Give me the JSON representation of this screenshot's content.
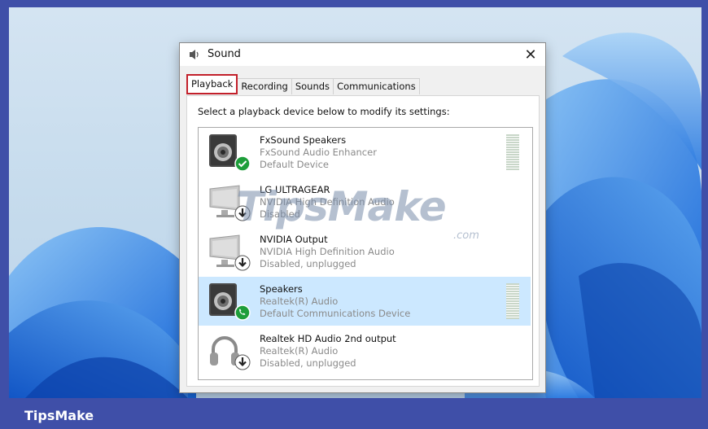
{
  "window": {
    "title": "Sound",
    "close_glyph": "✕",
    "icon": "speaker-icon"
  },
  "tabs": [
    {
      "label": "Playback",
      "active": true
    },
    {
      "label": "Recording",
      "active": false
    },
    {
      "label": "Sounds",
      "active": false
    },
    {
      "label": "Communications",
      "active": false
    }
  ],
  "instructions": "Select a playback device below to modify its settings:",
  "devices": [
    {
      "name": "FxSound Speakers",
      "line1": "FxSound Audio Enhancer",
      "line2": "Default Device",
      "icon": "speaker-icon",
      "badge": "check-badge-icon",
      "selected": false
    },
    {
      "name": "LG ULTRAGEAR",
      "line1": "NVIDIA High Definition Audio",
      "line2": "Disabled",
      "icon": "monitor-icon",
      "badge": "down-arrow-badge-icon",
      "selected": false
    },
    {
      "name": "NVIDIA Output",
      "line1": "NVIDIA High Definition Audio",
      "line2": "Disabled, unplugged",
      "icon": "monitor-icon",
      "badge": "down-arrow-badge-icon",
      "selected": false
    },
    {
      "name": "Speakers",
      "line1": "Realtek(R) Audio",
      "line2": "Default Communications Device",
      "icon": "speaker-icon",
      "badge": "phone-badge-icon",
      "selected": true
    },
    {
      "name": "Realtek HD Audio 2nd output",
      "line1": "Realtek(R) Audio",
      "line2": "Disabled, unplugged",
      "icon": "headphones-icon",
      "badge": "down-arrow-badge-icon",
      "selected": false
    }
  ],
  "watermark": {
    "text": "TipsMake",
    "suffix": ".com"
  },
  "footer": {
    "brand": "TipsMake"
  },
  "colors": {
    "accent_highlight": "#c2202a",
    "selection": "#cce8ff",
    "footer": "#3f4fa8",
    "check_badge": "#1e9e3a"
  }
}
